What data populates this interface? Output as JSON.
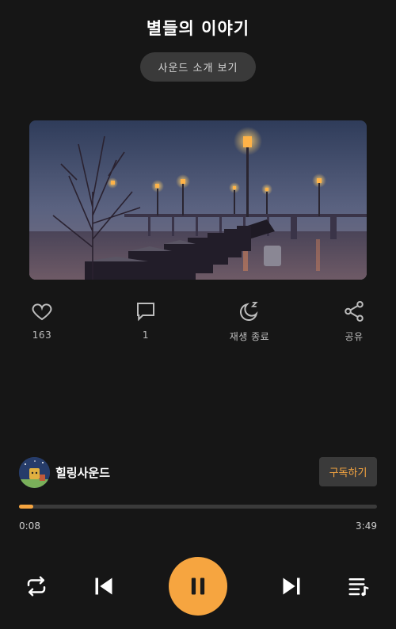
{
  "header": {
    "title": "별들의 이야기",
    "intro_button": "사운드 소개 보기"
  },
  "actions": {
    "like_count": "163",
    "comment_count": "1",
    "sleep_timer_label": "재생 종료",
    "share_label": "공유"
  },
  "channel": {
    "name": "힐링사운드",
    "subscribe_label": "구독하기"
  },
  "player": {
    "current_time": "0:08",
    "duration": "3:49",
    "progress": 0.04
  },
  "colors": {
    "accent": "#f6a540",
    "background": "#161616"
  },
  "icons": [
    "heart-icon",
    "comment-icon",
    "moon-sleep-icon",
    "share-icon",
    "repeat-icon",
    "previous-icon",
    "pause-icon",
    "next-icon",
    "playlist-icon"
  ]
}
